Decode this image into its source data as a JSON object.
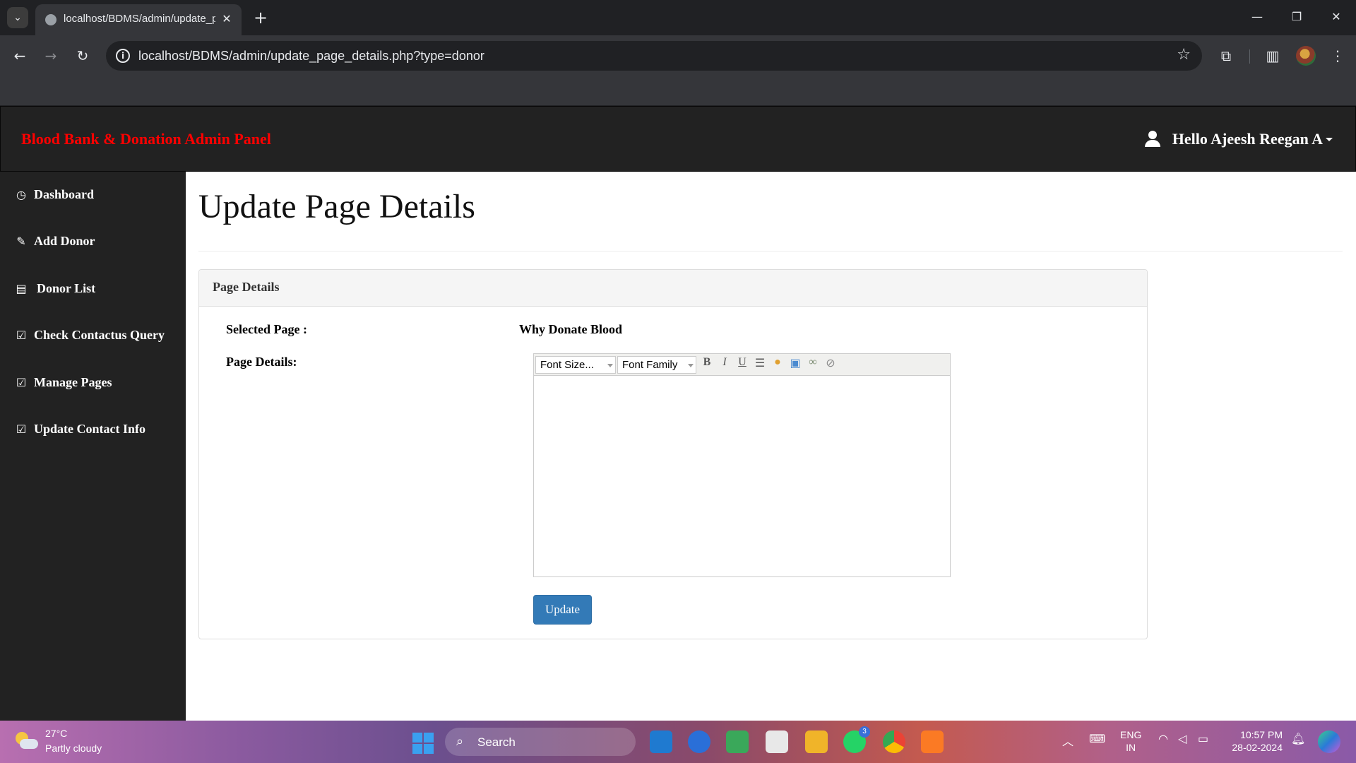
{
  "browser": {
    "tab_title": "localhost/BDMS/admin/update_page_details.php?type=donor",
    "url": "localhost/BDMS/admin/update_page_details.php?type=donor"
  },
  "header": {
    "brand": "Blood Bank & Donation Admin Panel",
    "user_greeting": "Hello Ajeesh Reegan A"
  },
  "sidebar": {
    "items": [
      {
        "label": "Dashboard",
        "icon": "dashboard-icon"
      },
      {
        "label": "Add Donor",
        "icon": "pencil-icon"
      },
      {
        "label": "Donor List",
        "icon": "list-icon"
      },
      {
        "label": "Check Contactus Query",
        "icon": "edit-icon"
      },
      {
        "label": "Manage Pages",
        "icon": "edit-icon"
      },
      {
        "label": "Update Contact Info",
        "icon": "edit-icon"
      }
    ]
  },
  "main": {
    "title": "Update Page Details",
    "panel_heading": "Page Details",
    "selected_page_label": "Selected Page :",
    "selected_page_value": "Why Donate Blood",
    "page_details_label": "Page Details:",
    "editor": {
      "font_size_placeholder": "Font Size...",
      "font_family_placeholder": "Font Family",
      "content": ""
    },
    "update_button": "Update"
  },
  "taskbar": {
    "temperature": "27°C",
    "weather": "Partly cloudy",
    "search_label": "Search",
    "whatsapp_badge": "3",
    "lang_line1": "ENG",
    "lang_line2": "IN",
    "time": "10:57 PM",
    "date": "28-02-2024"
  },
  "colors": {
    "brand": "#ff0000",
    "navbar": "#222222",
    "primary_button": "#337ab7"
  }
}
